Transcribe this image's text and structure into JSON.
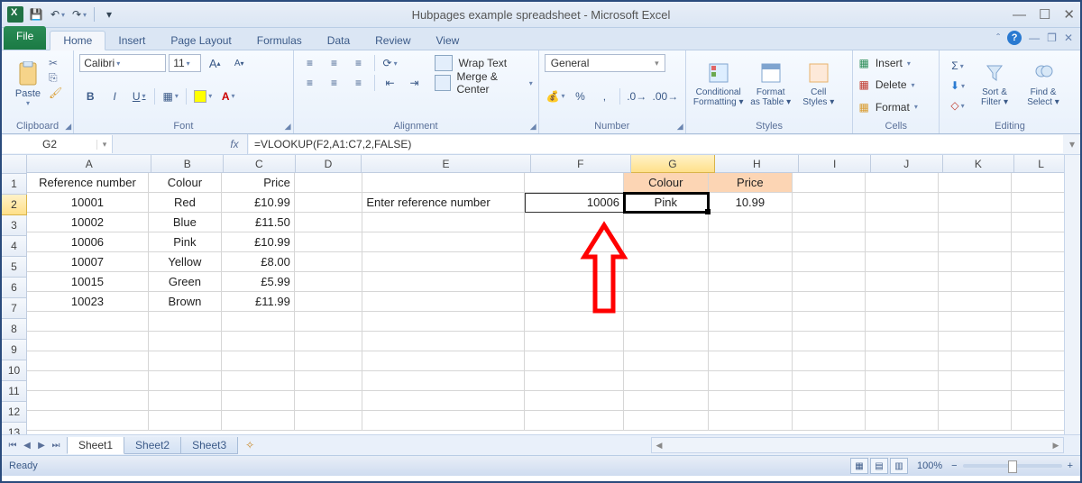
{
  "window": {
    "title": "Hubpages example spreadsheet  -  Microsoft Excel",
    "minimize": "—",
    "maximize": "☐",
    "close": "✕"
  },
  "qat": {
    "save": "💾",
    "undo": "↶",
    "redo": "↷",
    "customize": "▾"
  },
  "tabs": {
    "file": "File",
    "home": "Home",
    "insert": "Insert",
    "page_layout": "Page Layout",
    "formulas": "Formulas",
    "data": "Data",
    "review": "Review",
    "view": "View"
  },
  "ribbon": {
    "clipboard": {
      "paste": "Paste",
      "label": "Clipboard"
    },
    "font": {
      "name": "Calibri",
      "size": "11",
      "bold": "B",
      "italic": "I",
      "underline": "U",
      "grow": "A",
      "shrink": "A",
      "label": "Font"
    },
    "alignment": {
      "wrap": "Wrap Text",
      "merge": "Merge & Center",
      "label": "Alignment"
    },
    "number": {
      "format": "General",
      "label": "Number"
    },
    "styles": {
      "cond": "Conditional Formatting",
      "table": "Format as Table",
      "cell": "Cell Styles",
      "label": "Styles"
    },
    "cells": {
      "insert": "Insert",
      "delete": "Delete",
      "format": "Format",
      "label": "Cells"
    },
    "editing": {
      "sort": "Sort & Filter",
      "find": "Find & Select",
      "label": "Editing"
    }
  },
  "namebox": "G2",
  "formula": "=VLOOKUP(F2,A1:C7,2,FALSE)",
  "columns": [
    "A",
    "B",
    "C",
    "D",
    "E",
    "F",
    "G",
    "H",
    "I",
    "J",
    "K",
    "L"
  ],
  "active_col": "G",
  "active_row": 2,
  "rows_shown": 13,
  "cells": {
    "A1": "Reference number",
    "B1": "Colour",
    "C1": "Price",
    "G1": "Colour",
    "H1": "Price",
    "A2": "10001",
    "B2": "Red",
    "C2": "£10.99",
    "A3": "10002",
    "B3": "Blue",
    "C3": "£11.50",
    "A4": "10006",
    "B4": "Pink",
    "C4": "£10.99",
    "A5": "10007",
    "B5": "Yellow",
    "C5": "£8.00",
    "A6": "10015",
    "B6": "Green",
    "C6": "£5.99",
    "A7": "10023",
    "B7": "Brown",
    "C7": "£11.99",
    "E2": "Enter reference number",
    "F2": "10006",
    "G2": "Pink",
    "H2": "10.99"
  },
  "sheets": {
    "s1": "Sheet1",
    "s2": "Sheet2",
    "s3": "Sheet3"
  },
  "status": {
    "ready": "Ready",
    "zoom": "100%"
  }
}
